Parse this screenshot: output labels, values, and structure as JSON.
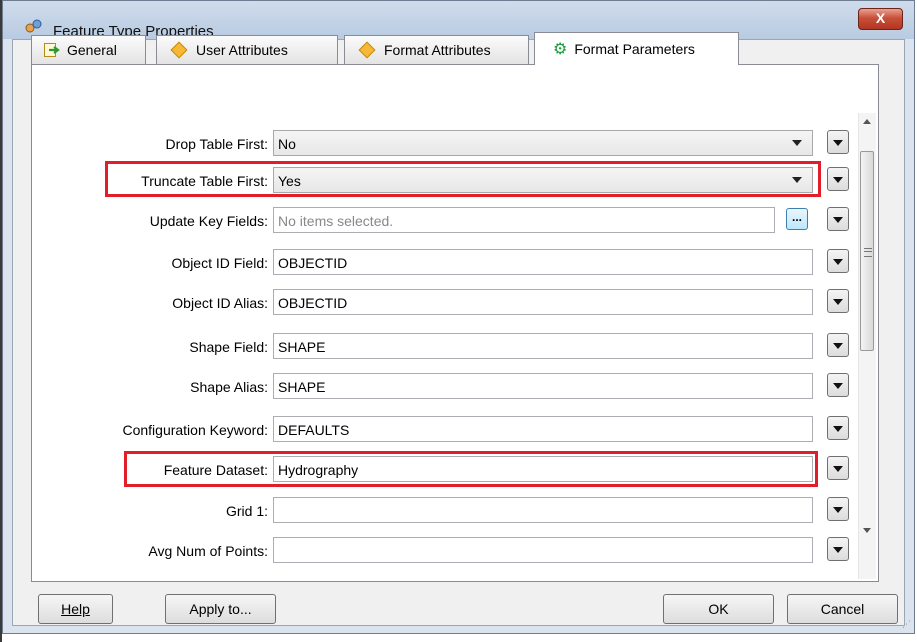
{
  "window": {
    "title": "Feature Type Properties",
    "close_label": "X"
  },
  "tabs": [
    {
      "label": "General"
    },
    {
      "label": "User Attributes"
    },
    {
      "label": "Format Attributes"
    },
    {
      "label": "Format Parameters"
    }
  ],
  "params": {
    "drop_table_first": {
      "label": "Drop Table First:",
      "value": "No"
    },
    "truncate_table_first": {
      "label": "Truncate Table First:",
      "value": "Yes"
    },
    "update_key_fields": {
      "label": "Update Key Fields:",
      "placeholder": "No items selected.",
      "button": "..."
    },
    "object_id_field": {
      "label": "Object ID Field:",
      "value": "OBJECTID"
    },
    "object_id_alias": {
      "label": "Object ID Alias:",
      "value": "OBJECTID"
    },
    "shape_field": {
      "label": "Shape Field:",
      "value": "SHAPE"
    },
    "shape_alias": {
      "label": "Shape Alias:",
      "value": "SHAPE"
    },
    "configuration_keyword": {
      "label": "Configuration Keyword:",
      "value": "DEFAULTS"
    },
    "feature_dataset": {
      "label": "Feature Dataset:",
      "value": "Hydrography"
    },
    "grid_1": {
      "label": "Grid 1:",
      "value": ""
    },
    "avg_num_points": {
      "label": "Avg Num of Points:",
      "value": ""
    }
  },
  "buttons": {
    "help": "Help",
    "apply": "Apply to...",
    "ok": "OK",
    "cancel": "Cancel"
  },
  "colors": {
    "highlight": "#e31e2b",
    "titlebar": "#c3d3e8"
  }
}
